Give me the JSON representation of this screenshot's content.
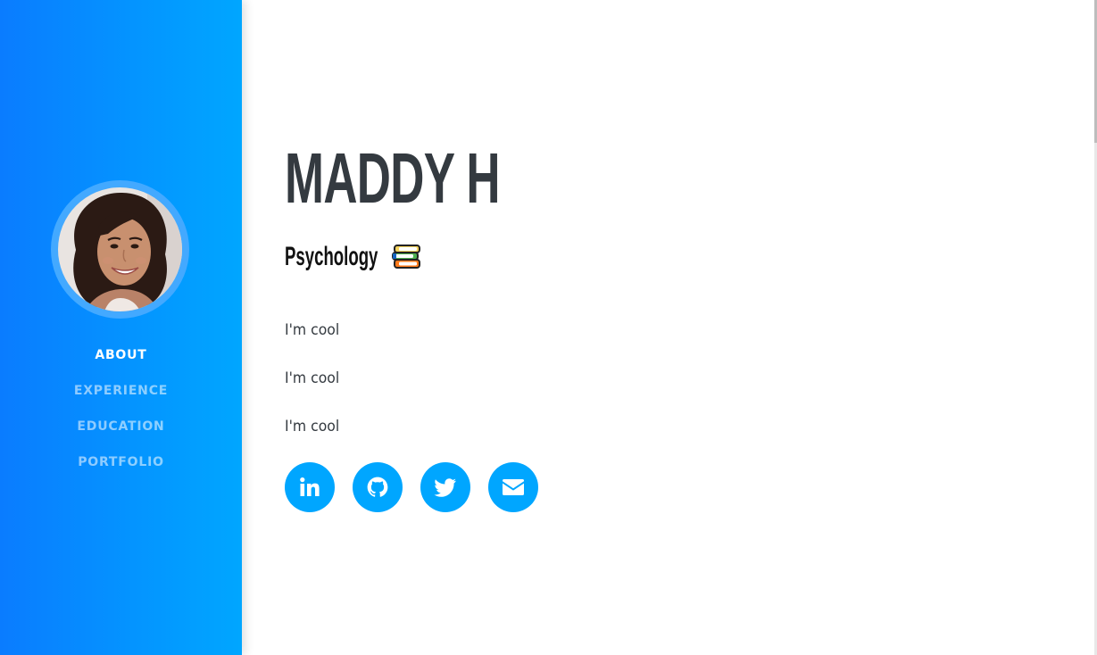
{
  "profile": {
    "name": "MADDY H",
    "subtitle": "Psychology",
    "subtitle_emoji_icon": "books-icon",
    "avatar_alt": "profile-photo"
  },
  "sidebar": {
    "nav": [
      {
        "label": "ABOUT",
        "active": true
      },
      {
        "label": "EXPERIENCE",
        "active": false
      },
      {
        "label": "EDUCATION",
        "active": false
      },
      {
        "label": "PORTFOLIO",
        "active": false
      }
    ]
  },
  "about": {
    "lines": [
      "I'm cool",
      "I'm cool",
      "I'm cool"
    ]
  },
  "social": [
    {
      "icon": "linkedin-icon"
    },
    {
      "icon": "github-icon"
    },
    {
      "icon": "twitter-icon"
    },
    {
      "icon": "envelope-icon"
    }
  ],
  "colors": {
    "sidebar_gradient_start": "#0a7cff",
    "sidebar_gradient_end": "#00a6ff",
    "social_button": "#00a6ff",
    "heading": "#343a40"
  }
}
